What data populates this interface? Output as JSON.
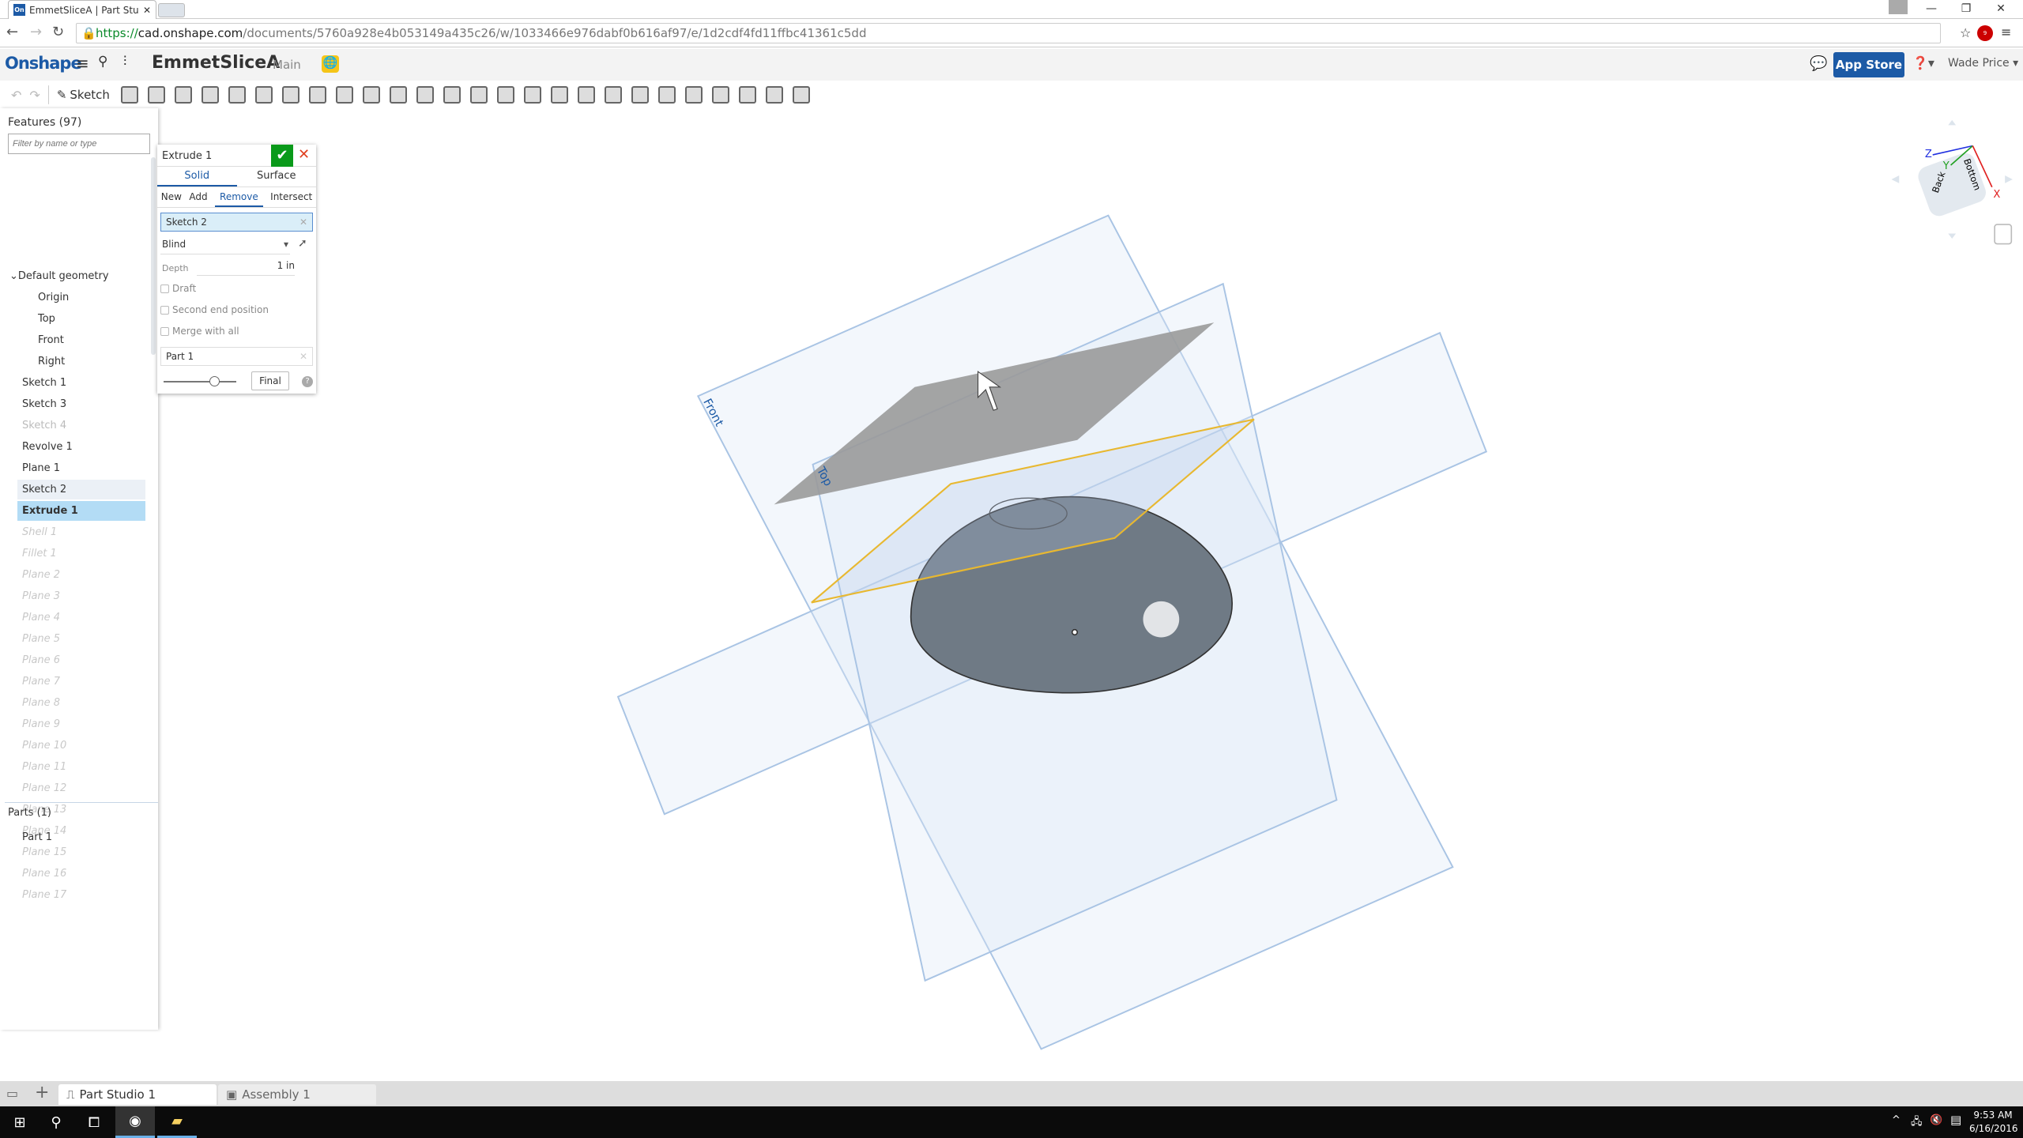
{
  "browser": {
    "tab_title": "EmmetSliceA | Part Studio",
    "favicon": "On",
    "url_scheme": "https://",
    "url_host": "cad.onshape.com",
    "url_path": "/documents/5760a928e4b053149a435c26/w/1033466e976dabf0b616af97/e/1d2cdf4fd11ffbc41361c5dd",
    "abp_count": "9"
  },
  "header": {
    "logo": "Onshape",
    "document": "EmmetSliceA",
    "branch": "Main",
    "app_store": "App Store",
    "user": "Wade Price"
  },
  "toolbar": {
    "sketch": "Sketch",
    "icons": [
      "extrude-icon",
      "revolve-icon",
      "sweep-icon",
      "loft-icon",
      "thicken-icon",
      "fillet-icon",
      "chamfer-icon",
      "draft-icon",
      "shell-icon",
      "hole-icon",
      "pattern-icon",
      "mirror-icon",
      "boolean-icon",
      "split-icon",
      "transform-icon",
      "delete-part-icon",
      "move-face-icon",
      "replace-face-icon",
      "offset-surface-icon",
      "fill-icon",
      "plane-icon",
      "helix-icon",
      "mate-connector-icon",
      "import-icon",
      "variable-icon",
      "add-custom-feature-icon"
    ]
  },
  "features": {
    "title": "Features (97)",
    "filter_placeholder": "Filter by name or type",
    "items": [
      {
        "label": "Default geometry",
        "state": "group"
      },
      {
        "label": "Origin",
        "state": "indent"
      },
      {
        "label": "Top",
        "state": "indent"
      },
      {
        "label": "Front",
        "state": "indent"
      },
      {
        "label": "Right",
        "state": "indent"
      },
      {
        "label": "Sketch 1",
        "state": "normal"
      },
      {
        "label": "Sketch 3",
        "state": "normal"
      },
      {
        "label": "Sketch 4",
        "state": "hidden"
      },
      {
        "label": "Revolve 1",
        "state": "normal"
      },
      {
        "label": "Plane 1",
        "state": "normal"
      },
      {
        "label": "Sketch 2",
        "state": "hover"
      },
      {
        "label": "Extrude 1",
        "state": "selected"
      },
      {
        "label": "Shell 1",
        "state": "rolled-back"
      },
      {
        "label": "Fillet 1",
        "state": "rolled-back"
      },
      {
        "label": "Plane 2",
        "state": "rolled-back"
      },
      {
        "label": "Plane 3",
        "state": "rolled-back"
      },
      {
        "label": "Plane 4",
        "state": "rolled-back"
      },
      {
        "label": "Plane 5",
        "state": "rolled-back"
      },
      {
        "label": "Plane 6",
        "state": "rolled-back"
      },
      {
        "label": "Plane 7",
        "state": "rolled-back"
      },
      {
        "label": "Plane 8",
        "state": "rolled-back"
      },
      {
        "label": "Plane 9",
        "state": "rolled-back"
      },
      {
        "label": "Plane 10",
        "state": "rolled-back"
      },
      {
        "label": "Plane 11",
        "state": "rolled-back"
      },
      {
        "label": "Plane 12",
        "state": "rolled-back"
      },
      {
        "label": "Plane 13",
        "state": "rolled-back"
      },
      {
        "label": "Plane 14",
        "state": "rolled-back"
      },
      {
        "label": "Plane 15",
        "state": "rolled-back"
      },
      {
        "label": "Plane 16",
        "state": "rolled-back"
      },
      {
        "label": "Plane 17",
        "state": "rolled-back"
      }
    ],
    "parts_title": "Parts (1)",
    "parts": [
      "Part 1"
    ]
  },
  "dialog": {
    "title": "Extrude 1",
    "types": [
      "Solid",
      "Surface"
    ],
    "active_type": "Solid",
    "ops": [
      "New",
      "Add",
      "Remove",
      "Intersect"
    ],
    "active_op": "Remove",
    "selection": "Sketch 2",
    "end_type": "Blind",
    "depth_label": "Depth",
    "depth_value": "1 in",
    "draft": "Draft",
    "second_end": "Second end position",
    "merge_all": "Merge with all",
    "merge_scope": "Part 1",
    "final": "Final",
    "slider_value": 0.7
  },
  "viewport": {
    "plane_labels": [
      "Front",
      "Top"
    ],
    "cube_faces": [
      "Back",
      "Bottom"
    ],
    "axes": [
      "X",
      "Y",
      "Z"
    ],
    "colors": {
      "plane": "#a9c4e4",
      "sketch": "#e8b830",
      "x": "#e02020",
      "y": "#20a020",
      "z": "#2030e0"
    }
  },
  "tabs": [
    "Part Studio 1",
    "Assembly 1"
  ],
  "taskbar": {
    "time": "9:53 AM",
    "date": "6/16/2016"
  }
}
